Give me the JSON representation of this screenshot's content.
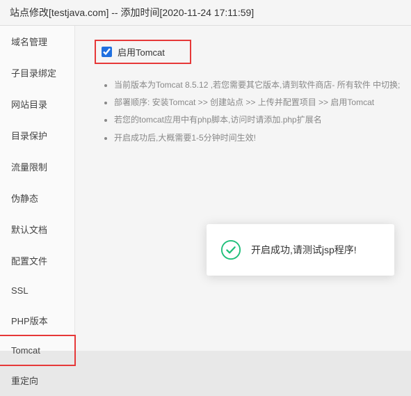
{
  "header": {
    "title": "站点修改[testjava.com] -- 添加时间[2020-11-24 17:11:59]"
  },
  "sidebar": {
    "items": [
      {
        "label": "域名管理"
      },
      {
        "label": "子目录绑定"
      },
      {
        "label": "网站目录"
      },
      {
        "label": "目录保护"
      },
      {
        "label": "流量限制"
      },
      {
        "label": "伪静态"
      },
      {
        "label": "默认文档"
      },
      {
        "label": "配置文件"
      },
      {
        "label": "SSL"
      },
      {
        "label": "PHP版本"
      },
      {
        "label": "Tomcat"
      },
      {
        "label": "重定向"
      }
    ]
  },
  "content": {
    "enable_checkbox_label": "启用Tomcat",
    "notes": [
      "当前版本为Tomcat 8.5.12 ,若您需要其它版本,请到软件商店- 所有软件 中切换;",
      "部署顺序: 安装Tomcat >> 创建站点 >> 上传并配置项目 >> 启用Tomcat",
      "若您的tomcat应用中有php脚本,访问时请添加.php扩展名",
      "开启成功后,大概需要1-5分钟时间生效!"
    ]
  },
  "toast": {
    "message": "开启成功,请测试jsp程序!"
  }
}
